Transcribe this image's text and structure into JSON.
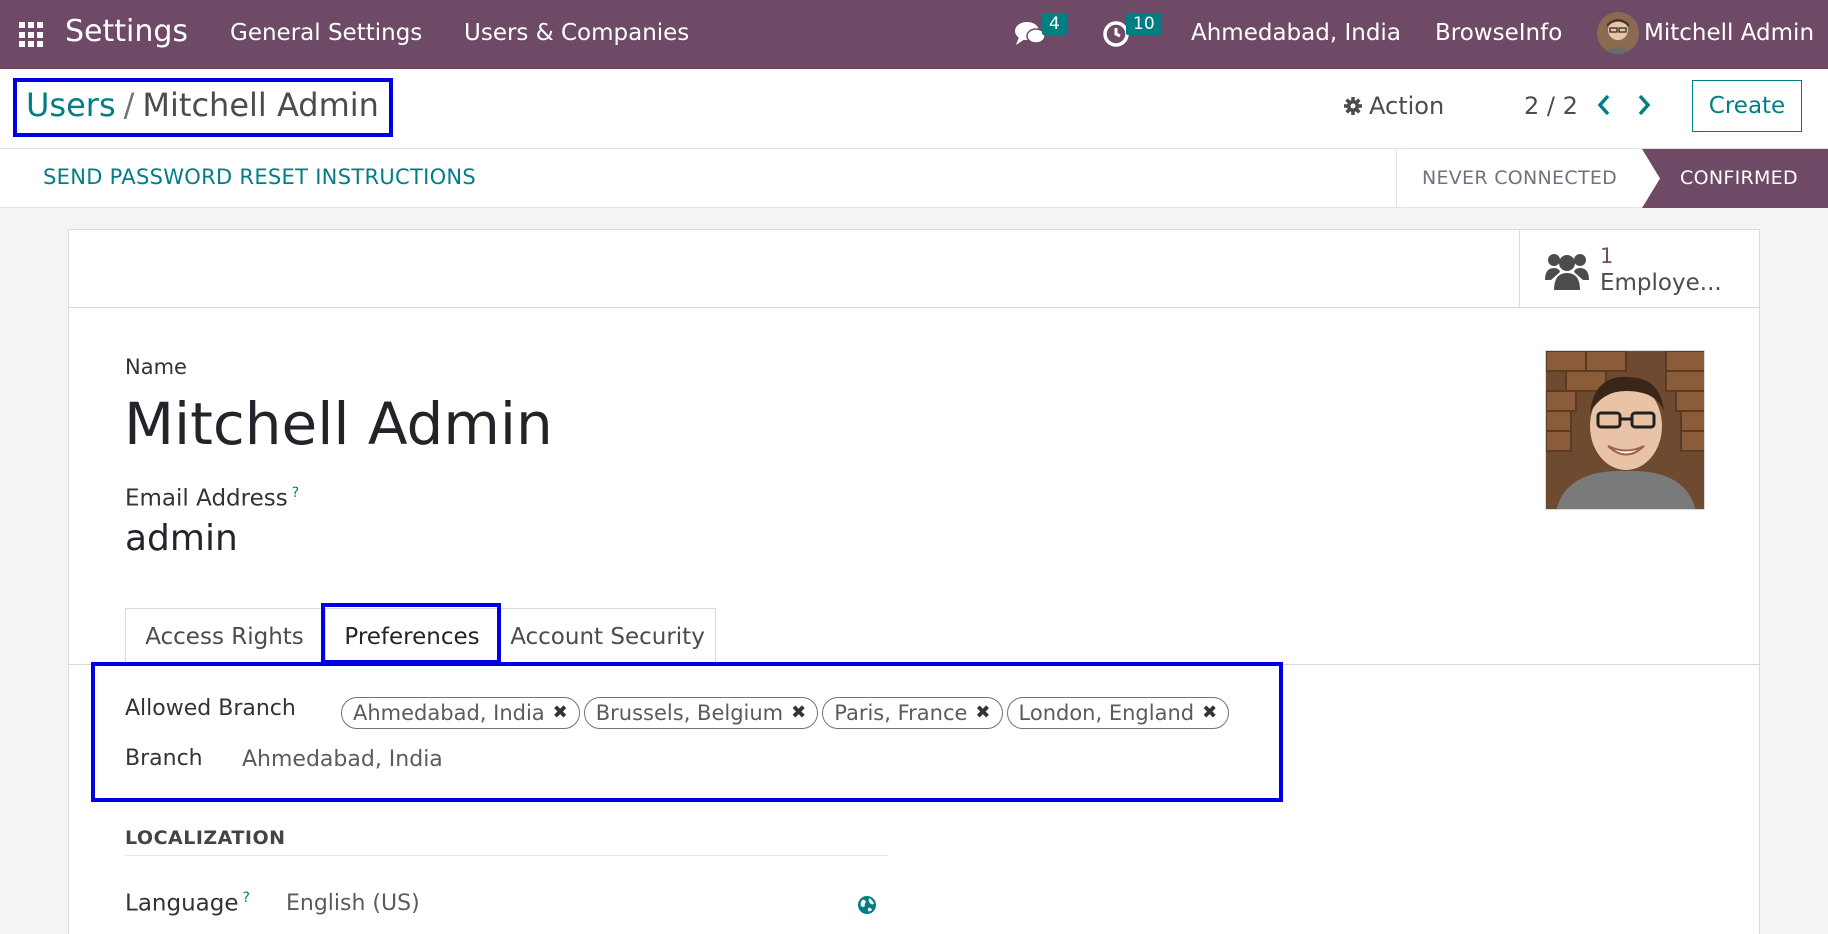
{
  "navbar": {
    "app_title": "Settings",
    "menu": [
      "General Settings",
      "Users & Companies"
    ],
    "messages_count": "4",
    "activities_count": "10",
    "branch": "Ahmedabad, India",
    "company": "BrowseInfo",
    "user": "Mitchell Admin",
    "icons": [
      "apps-grid-icon",
      "chat-icon",
      "clock-icon",
      "avatar"
    ]
  },
  "control_panel": {
    "breadcrumb_parent": "Users",
    "breadcrumb_separator": "/",
    "breadcrumb_current": "Mitchell Admin",
    "action_label": "Action",
    "pager": "2 / 2",
    "prev_label": "‹",
    "next_label": "›",
    "create_label": "Create"
  },
  "statusbar": {
    "reset_button": "SEND PASSWORD RESET INSTRUCTIONS",
    "stages": [
      "NEVER CONNECTED",
      "CONFIRMED"
    ],
    "active_stage": "CONFIRMED"
  },
  "button_box": {
    "employee_count": "1",
    "employee_label": "Employe..."
  },
  "form": {
    "name_label": "Name",
    "name_value": "Mitchell Admin",
    "email_label": "Email Address",
    "help_mark": "?",
    "email_value": "admin",
    "tabs": [
      "Access Rights",
      "Preferences",
      "Account Security"
    ],
    "active_tab": "Preferences"
  },
  "preferences": {
    "allowed_branch_label": "Allowed Branch",
    "allowed_branches": [
      "Ahmedabad, India",
      "Brussels, Belgium",
      "Paris, France",
      "London, England"
    ],
    "branch_label": "Branch",
    "branch_value": "Ahmedabad, India",
    "localization_heading": "LOCALIZATION",
    "language_label": "Language",
    "language_value": "English (US)"
  },
  "colors": {
    "navbar": "#6f4a67",
    "accent": "#017e84",
    "highlight_box": "#0000e6"
  }
}
